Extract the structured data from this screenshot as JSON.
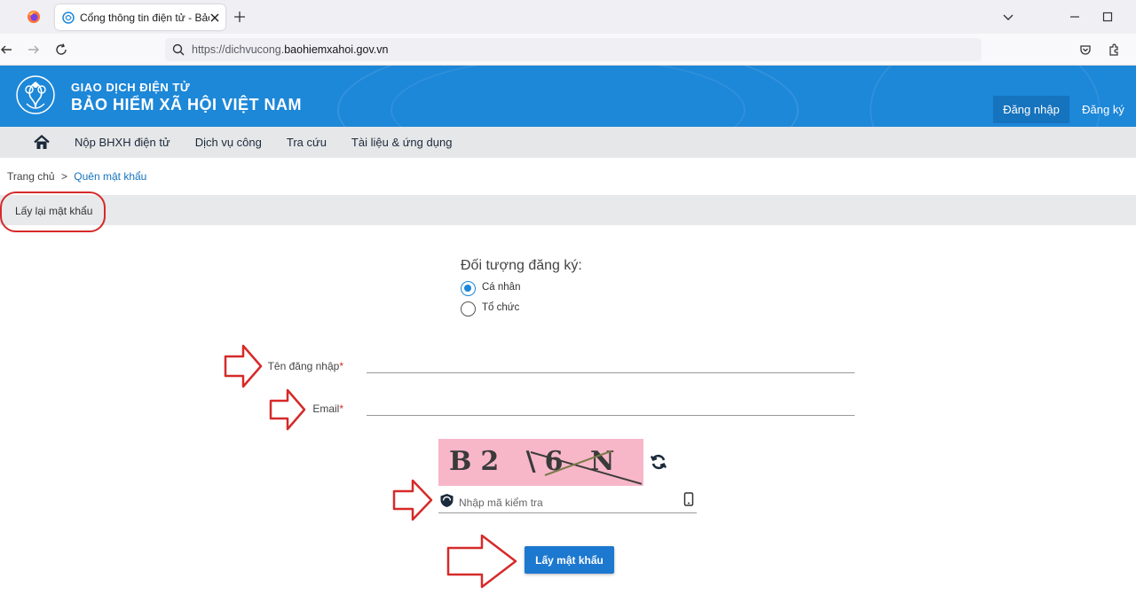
{
  "browser": {
    "tab_title": "Cổng thông tin điện tử - Bảo hiểm",
    "url_prefix": "https://dichvucong.",
    "url_domain": "baohiemxahoi.gov.vn"
  },
  "header": {
    "brand_line1": "GIAO DỊCH ĐIỆN TỬ",
    "brand_line2": "BẢO HIỂM XÃ HỘI VIỆT NAM",
    "login": "Đăng nhập",
    "register": "Đăng ký",
    "brand_color": "#1d87d8"
  },
  "nav": {
    "items": [
      "Nộp BHXH điện tử",
      "Dịch vụ công",
      "Tra cứu",
      "Tài liệu & ứng dụng"
    ]
  },
  "breadcrumb": {
    "home": "Trang chủ",
    "separator": ">",
    "current": "Quên mật khẩu"
  },
  "section": {
    "title": "Lấy lại mật khẩu"
  },
  "form": {
    "subject_label": "Đối tượng đăng ký:",
    "options": [
      {
        "label": "Cá nhân",
        "checked": true
      },
      {
        "label": "Tổ chức",
        "checked": false
      }
    ],
    "username_label": "Tên đăng nhập",
    "email_label": "Email",
    "required_mark": "*",
    "username_value": "",
    "email_value": "",
    "captcha_text": "B2 \\6 N",
    "captcha_placeholder": "Nhập mã kiểm tra",
    "submit": "Lấy mật khẩu"
  },
  "icons": {
    "tab_favicon": "globe-icon",
    "new_tab": "plus-icon",
    "refresh_captcha": "refresh-icon",
    "captcha_field": "shield-icon",
    "captcha_mobile": "mobile-phone-icon"
  },
  "annotation_color": "#d62a2a"
}
